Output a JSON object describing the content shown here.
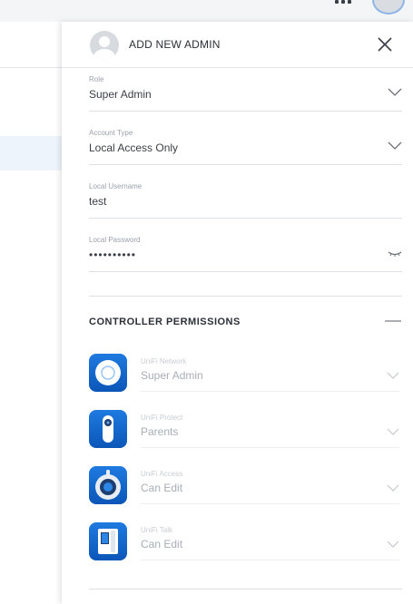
{
  "topbar": {
    "apps_icon": "apps-grid-icon",
    "avatar_icon": "user-avatar-icon"
  },
  "drawer": {
    "title": "ADD NEW ADMIN",
    "close_icon": "close-icon",
    "fields": {
      "role": {
        "label": "Role",
        "value": "Super Admin"
      },
      "account_type": {
        "label": "Account Type",
        "value": "Local Access Only"
      },
      "username": {
        "label": "Local Username",
        "value": "test"
      },
      "password": {
        "label": "Local Password",
        "value": "••••••••••"
      }
    },
    "permissions": {
      "title": "CONTROLLER PERMISSIONS",
      "apps": [
        {
          "name": "UniFi Network",
          "value": "Super Admin",
          "icon": "unifi-network-icon"
        },
        {
          "name": "UniFi Protect",
          "value": "Parents",
          "icon": "unifi-protect-icon"
        },
        {
          "name": "UniFi Access",
          "value": "Can Edit",
          "icon": "unifi-access-icon"
        },
        {
          "name": "UniFi Talk",
          "value": "Can Edit",
          "icon": "unifi-talk-icon"
        }
      ]
    }
  },
  "colors": {
    "accent": "#1f7ae0",
    "text": "#2b2f36",
    "muted": "#9aa1ab"
  }
}
